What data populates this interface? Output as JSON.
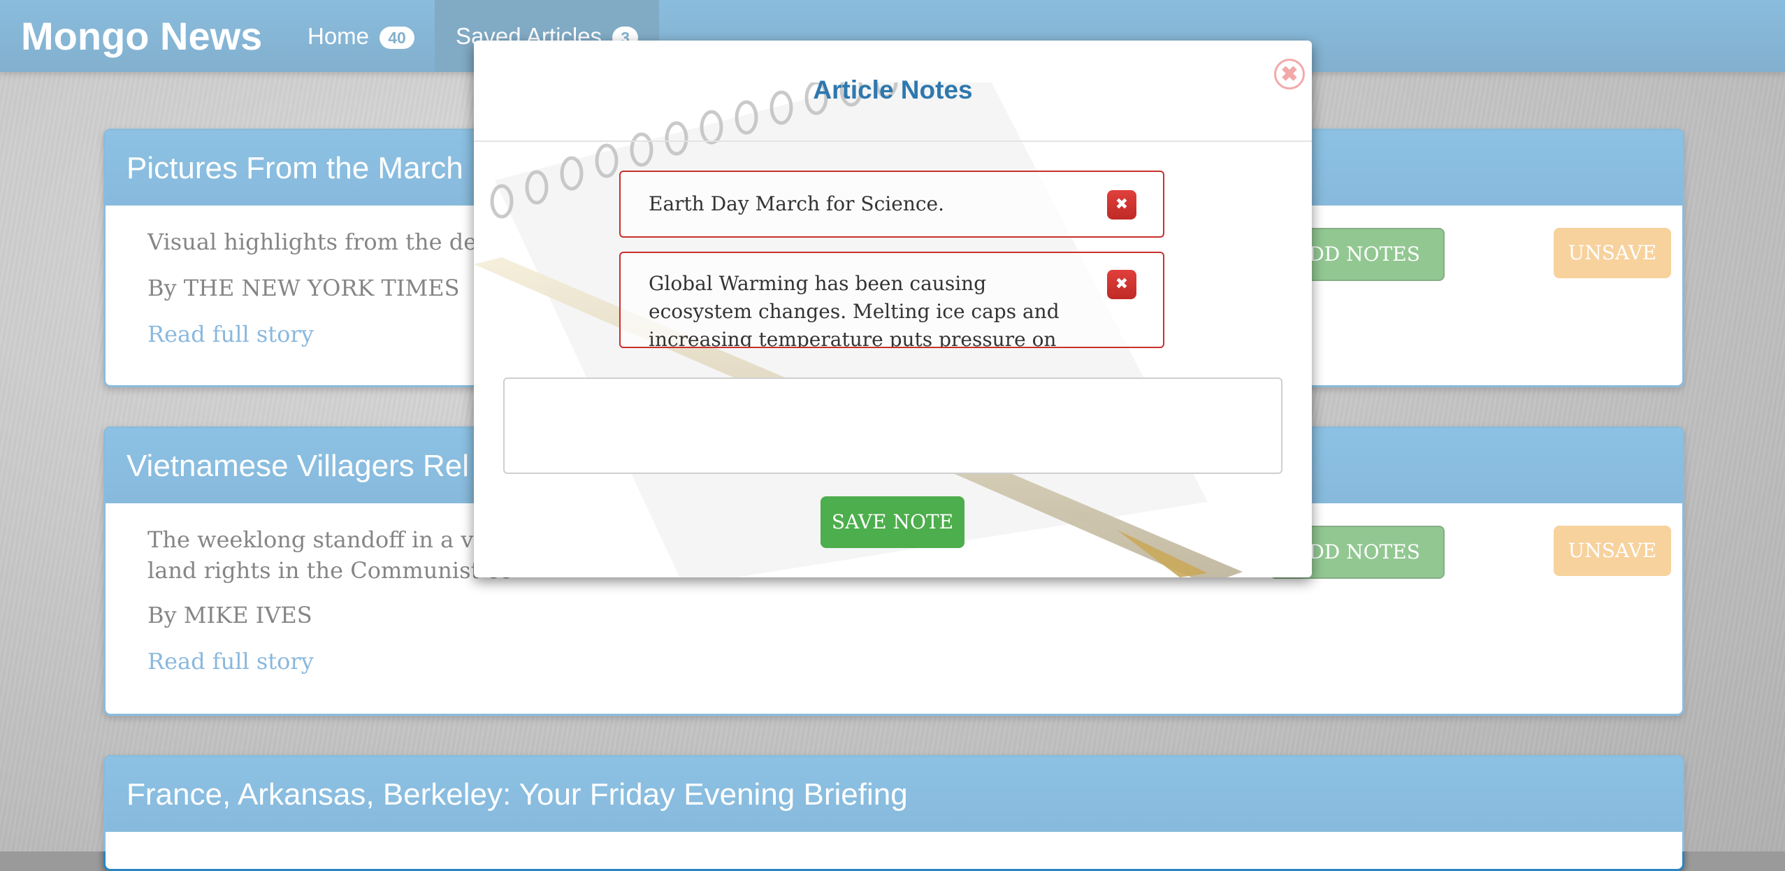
{
  "navbar": {
    "brand": "Mongo News",
    "home_label": "Home",
    "home_count": "40",
    "saved_label": "Saved Articles",
    "saved_count": "3"
  },
  "articles": [
    {
      "title": "Pictures From the March",
      "summary": "Visual highlights from the dem",
      "byline": "By THE NEW YORK TIMES",
      "link": "Read full story",
      "add_notes": "ADD NOTES",
      "unsave": "UNSAVE"
    },
    {
      "title": "Vietnamese Villagers Rel",
      "summary_line1": "The weeklong standoff in a vill",
      "summary_line2": "land rights in the Communist co",
      "byline": "By MIKE IVES",
      "link": "Read full story",
      "add_notes": "ADD NOTES",
      "unsave": "UNSAVE"
    },
    {
      "title": "France, Arkansas, Berkeley: Your Friday Evening Briefing"
    }
  ],
  "modal": {
    "title": "Article Notes",
    "close_glyph": "✖",
    "notes": [
      {
        "text": "Earth Day March for Science.",
        "delete_glyph": "✖"
      },
      {
        "text": "Global Warming has been causing ecosystem changes. Melting ice caps and increasing temperature puts pressure on polar bears.",
        "delete_glyph": "✖"
      }
    ],
    "input_value": "",
    "save_label": "SAVE NOTE"
  }
}
